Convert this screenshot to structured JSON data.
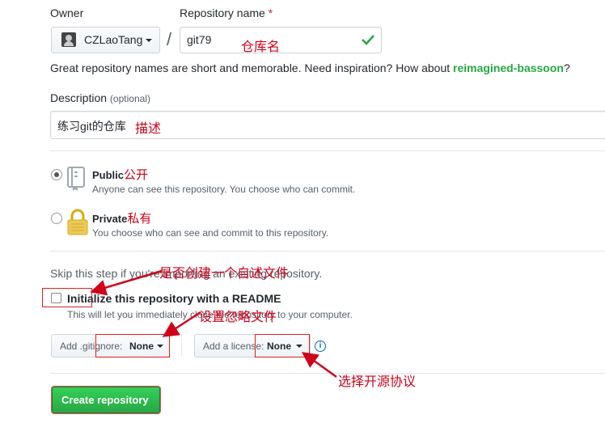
{
  "owner": {
    "label": "Owner",
    "value": "CZLaoTang"
  },
  "repo": {
    "label": "Repository name",
    "required_mark": "*",
    "value": "git79",
    "annotation": "仓库名"
  },
  "hint": {
    "prefix": "Great repository names are short and memorable. Need inspiration? How about ",
    "suggestion": "reimagined-bassoon",
    "suffix": "?"
  },
  "description": {
    "label": "Description",
    "optional": "(optional)",
    "value": "练习git的仓库",
    "annotation": "描述"
  },
  "visibility": {
    "public": {
      "title": "Public",
      "annotation": "公开",
      "desc": "Anyone can see this repository. You choose who can commit."
    },
    "private": {
      "title": "Private",
      "annotation": "私有",
      "desc": "You choose who can see and commit to this repository."
    }
  },
  "init": {
    "skip_text": "Skip this step if you're importing an existing repository.",
    "readme_label": "Initialize this repository with a README",
    "readme_desc": "This will let you immediately clone the repository to your computer.",
    "annotation": "是否创建一个自述文件"
  },
  "gitignore": {
    "prefix": "Add .gitignore:",
    "value": "None",
    "annotation": "设置忽略文件"
  },
  "license": {
    "prefix": "Add a license:",
    "value": "None",
    "annotation": "选择开源协议"
  },
  "submit": {
    "label": "Create repository"
  },
  "colors": {
    "annotation_red": "#d0021b",
    "suggestion_green": "#28a745",
    "submit_green": "#2ea44f",
    "info_blue": "#0366d6"
  }
}
